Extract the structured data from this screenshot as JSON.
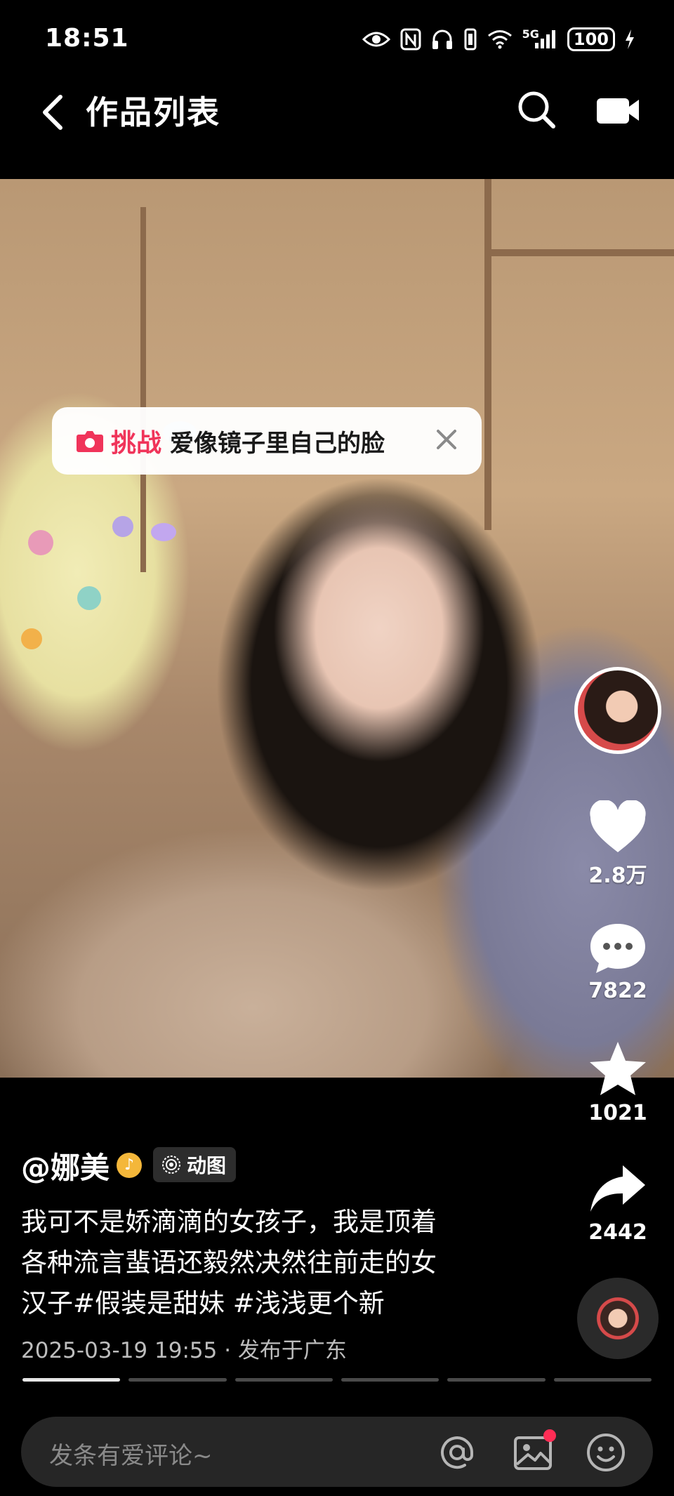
{
  "status_bar": {
    "time": "18:51",
    "network": "5G",
    "battery": "100"
  },
  "nav": {
    "title": "作品列表"
  },
  "challenge": {
    "tag": "挑战",
    "text": "爱像镜子里自己的脸"
  },
  "rail": {
    "likes": "2.8万",
    "comments": "7822",
    "favorites": "1021",
    "shares": "2442"
  },
  "post": {
    "author": "@娜美",
    "badge_label": "动图",
    "caption_lines": [
      "我可不是娇滴滴的女孩子，我是顶着",
      "各种流言蜚语还毅然决然往前走的女",
      "汉子#假装是甜妹 #浅浅更个新"
    ],
    "meta": "2025-03-19 19:55 · 发布于广东"
  },
  "progress": {
    "segments": 6,
    "active_index": 0
  },
  "comment_bar": {
    "placeholder": "发条有爱评论~"
  },
  "colors": {
    "accent": "#f0345a",
    "background": "#000000",
    "comment_bar": "#262626"
  }
}
